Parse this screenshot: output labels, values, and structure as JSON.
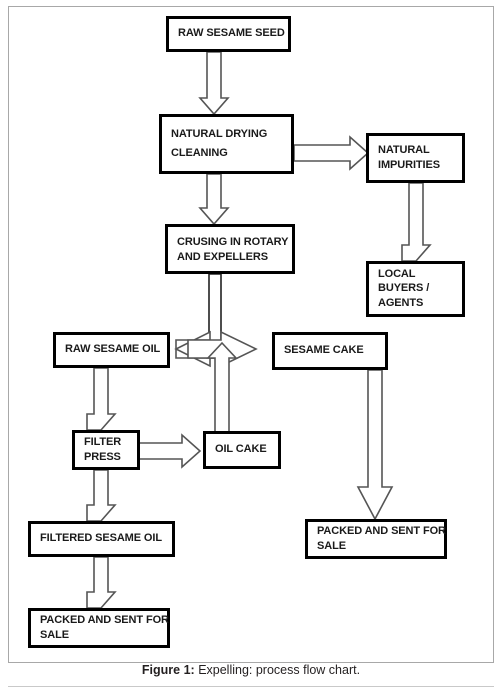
{
  "figure": {
    "caption_label": "Figure 1:",
    "caption_text": "Expelling: process flow chart."
  },
  "chart_data": {
    "type": "diagram",
    "title": "Expelling: process flow chart",
    "nodes": [
      {
        "id": "raw_sesame_seed",
        "lines": [
          "RAW SESAME SEED"
        ]
      },
      {
        "id": "natural_drying_cleaning",
        "lines": [
          "NATURAL DRYING",
          "CLEANING"
        ]
      },
      {
        "id": "natural_impurities",
        "lines": [
          "NATURAL",
          "IMPURITIES"
        ]
      },
      {
        "id": "local_buyers_agents",
        "lines": [
          "LOCAL",
          "BUYERS /",
          "AGENTS"
        ]
      },
      {
        "id": "crusing_rotary_expellers",
        "lines": [
          "CRUSING IN ROTARY",
          "AND EXPELLERS"
        ]
      },
      {
        "id": "raw_sesame_oil",
        "lines": [
          "RAW SESAME OIL"
        ]
      },
      {
        "id": "sesame_cake",
        "lines": [
          "SESAME  CAKE"
        ]
      },
      {
        "id": "filter_press",
        "lines": [
          "FILTER",
          "PRESS"
        ]
      },
      {
        "id": "oil_cake",
        "lines": [
          "OIL CAKE"
        ]
      },
      {
        "id": "filtered_sesame_oil",
        "lines": [
          "FILTERED SESAME OIL"
        ]
      },
      {
        "id": "packed_sent_sale_left",
        "lines": [
          "PACKED AND SENT FOR",
          "SALE"
        ]
      },
      {
        "id": "packed_sent_sale_right",
        "lines": [
          "PACKED AND SENT FOR",
          "SALE"
        ]
      }
    ],
    "edges": [
      {
        "from": "raw_sesame_seed",
        "to": "natural_drying_cleaning",
        "direction": "down"
      },
      {
        "from": "natural_drying_cleaning",
        "to": "natural_impurities",
        "direction": "right"
      },
      {
        "from": "natural_drying_cleaning",
        "to": "crusing_rotary_expellers",
        "direction": "down"
      },
      {
        "from": "natural_impurities",
        "to": "local_buyers_agents",
        "direction": "down"
      },
      {
        "from": "crusing_rotary_expellers",
        "to": "raw_sesame_oil",
        "direction": "down-left"
      },
      {
        "from": "crusing_rotary_expellers",
        "to": "sesame_cake",
        "direction": "down-right"
      },
      {
        "from": "oil_cake",
        "to": "crusing_rotary_expellers",
        "direction": "up"
      },
      {
        "from": "raw_sesame_oil",
        "to": "filter_press",
        "direction": "down"
      },
      {
        "from": "filter_press",
        "to": "oil_cake",
        "direction": "right"
      },
      {
        "from": "filter_press",
        "to": "filtered_sesame_oil",
        "direction": "down"
      },
      {
        "from": "filtered_sesame_oil",
        "to": "packed_sent_sale_left",
        "direction": "down"
      },
      {
        "from": "sesame_cake",
        "to": "packed_sent_sale_right",
        "direction": "down"
      }
    ],
    "colors": {
      "node_border": "#000000",
      "node_fill": "#ffffff",
      "arrow_stroke": "#555555",
      "frame_border": "#a8a8a8"
    }
  }
}
